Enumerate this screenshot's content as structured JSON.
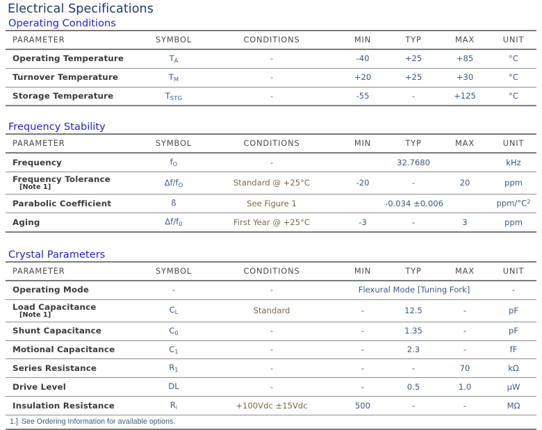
{
  "document": {
    "title": "Electrical Specifications",
    "title_color": "#1f3864",
    "section_color": "#2222cc"
  },
  "columns": [
    "PARAMETER",
    "SYMBOL",
    "CONDITIONS",
    "MIN",
    "TYP",
    "MAX",
    "UNIT"
  ],
  "sections": [
    {
      "name": "Operating Conditions",
      "rows": [
        {
          "parameter": "Operating Temperature",
          "symbol_base": "T",
          "symbol_sub": "A",
          "conditions": "-",
          "min": "-40",
          "typ": "+25",
          "max": "+85",
          "unit": "°C"
        },
        {
          "parameter": "Turnover Temperature",
          "symbol_base": "T",
          "symbol_sub": "M",
          "conditions": "-",
          "min": "+20",
          "typ": "+25",
          "max": "+30",
          "unit": "°C"
        },
        {
          "parameter": "Storage Temperature",
          "symbol_base": "T",
          "symbol_sub": "STG",
          "conditions": "-",
          "min": "-55",
          "typ": "-",
          "max": "+125",
          "unit": "°C"
        }
      ]
    },
    {
      "name": "Frequency Stability",
      "rows": [
        {
          "parameter": "Frequency",
          "symbol_base": "f",
          "symbol_sub": "O",
          "conditions": "-",
          "min": "",
          "typ": "32.7680",
          "max": "",
          "unit": "kHz"
        },
        {
          "parameter": "Frequency Tolerance",
          "note": "[Note 1]",
          "symbol_base": "Δf/f",
          "symbol_sub": "O",
          "conditions": "Standard @ +25°C",
          "min": "-20",
          "typ": "-",
          "max": "20",
          "unit": "ppm"
        },
        {
          "parameter": "Parabolic Coefficient",
          "symbol_base": "ß",
          "symbol_sub": "",
          "conditions": "See Figure 1",
          "span_value": "-0.034 ±0.006",
          "unit_base": "ppm/°C",
          "unit_sup": "2"
        },
        {
          "parameter": "Aging",
          "symbol_base": "Δf/f",
          "symbol_sub": "0",
          "conditions": "First Year @ +25°C",
          "min": "-3",
          "typ": "-",
          "max": "3",
          "unit": "ppm"
        }
      ]
    },
    {
      "name": "Crystal Parameters",
      "rows": [
        {
          "parameter": "Operating Mode",
          "symbol_base": "-",
          "symbol_sub": "",
          "conditions": "-",
          "span_value": "Flexural Mode [Tuning Fork]",
          "unit": "-"
        },
        {
          "parameter": "Load Capacitance",
          "note": "[Note 1]",
          "symbol_base": "C",
          "symbol_sub": "L",
          "conditions": "Standard",
          "min": "-",
          "typ": "12.5",
          "max": "-",
          "unit": "pF"
        },
        {
          "parameter": "Shunt Capacitance",
          "symbol_base": "C",
          "symbol_sub": "0",
          "conditions": "-",
          "min": "-",
          "typ": "1.35",
          "max": "-",
          "unit": "pF"
        },
        {
          "parameter": "Motional Capacitance",
          "symbol_base": "C",
          "symbol_sub": "1",
          "conditions": "-",
          "min": "-",
          "typ": "2.3",
          "max": "-",
          "unit": "fF"
        },
        {
          "parameter": "Series Resistance",
          "symbol_base": "R",
          "symbol_sub": "1",
          "conditions": "-",
          "min": "-",
          "typ": "-",
          "max": "70",
          "unit": "kΩ"
        },
        {
          "parameter": "Drive Level",
          "symbol_base": "DL",
          "symbol_sub": "",
          "conditions": "-",
          "min": "-",
          "typ": "0.5",
          "max": "1.0",
          "unit": "μW"
        },
        {
          "parameter": "Insulation Resistance",
          "symbol_base": "R",
          "symbol_sub": "i",
          "conditions": "+100Vdc ±15Vdc",
          "min": "500",
          "typ": "-",
          "max": "-",
          "unit": "MΩ"
        }
      ],
      "footnote": {
        "number": "1.]",
        "text": "See Ordering Information for available options."
      }
    }
  ]
}
